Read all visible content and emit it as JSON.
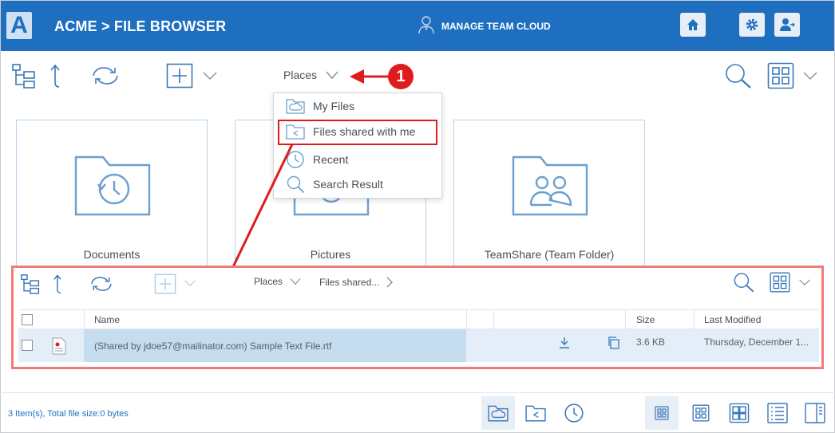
{
  "header": {
    "logo_letter": "A",
    "brand": "ACME > FILE BROWSER",
    "team_label": "MANAGE TEAM CLOUD"
  },
  "toolbar": {
    "places_label": "Places"
  },
  "annotation": {
    "callout_number": "1"
  },
  "places_menu": {
    "items": [
      {
        "label": "My Files",
        "icon": "cloud-folder-icon"
      },
      {
        "label": "Files shared with me",
        "icon": "shared-folder-icon"
      },
      {
        "label": "Recent",
        "icon": "clock-icon"
      },
      {
        "label": "Search Result",
        "icon": "search-icon"
      }
    ]
  },
  "tiles": [
    {
      "label": "Documents",
      "icon": "documents-folder-icon"
    },
    {
      "label": "Pictures",
      "icon": "pictures-folder-icon"
    },
    {
      "label": "TeamShare (Team Folder)",
      "icon": "team-folder-icon"
    }
  ],
  "panel": {
    "places_label": "Places",
    "breadcrumb_current": "Files shared...",
    "columns": {
      "name": "Name",
      "size": "Size",
      "modified": "Last Modified"
    },
    "rows": [
      {
        "name": "(Shared by jdoe57@mailinator.com) Sample Text File.rtf",
        "size": "3.6 KB",
        "modified": "Thursday, December 1..."
      }
    ]
  },
  "status": {
    "summary": "3 Item(s), Total file size:0 bytes"
  },
  "colors": {
    "header_bg": "#1f6fc0",
    "icon_blue": "#3a78b8",
    "highlight_red": "#e01b1b",
    "row_selected": "#c6dcef"
  }
}
